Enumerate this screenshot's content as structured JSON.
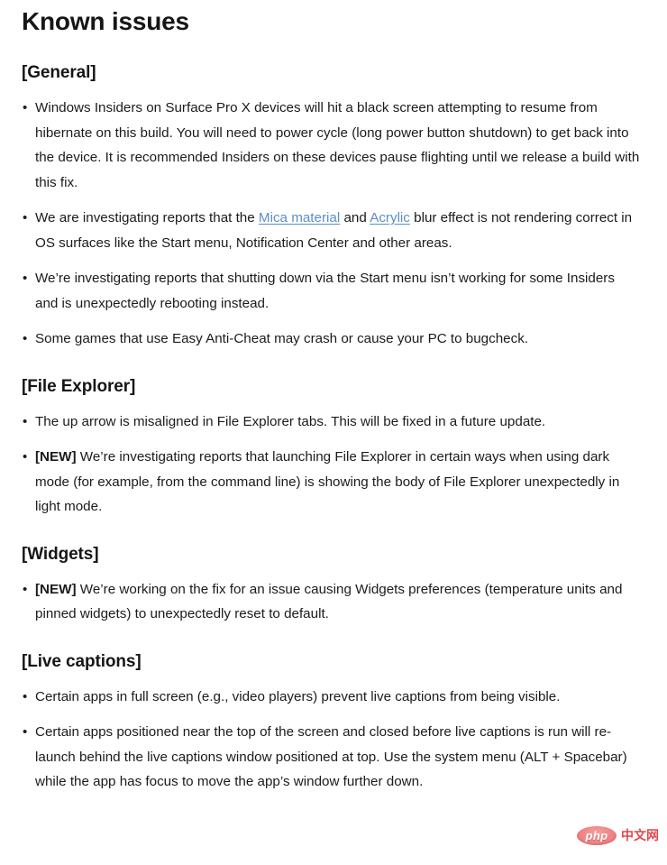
{
  "document": {
    "title": "Known issues",
    "link_color": "#5b8fc7",
    "text_color": "#1b1b1b",
    "background_color": "#ffffff",
    "bullet_glyph": "•",
    "new_tag": "[NEW]"
  },
  "sections": [
    {
      "heading": "[General]",
      "items": [
        {
          "text": "Windows Insiders on Surface Pro X devices will hit a black screen attempting to resume from hibernate on this build. You will need to power cycle (long power button shutdown) to get back into the device. It is recommended Insiders on these devices pause flighting until we release a build with this fix."
        },
        {
          "prefix": "We are investigating reports that the ",
          "link1": "Mica material",
          "mid": " and ",
          "link2": "Acrylic",
          "suffix": " blur effect is not rendering correct in OS surfaces like the Start menu, Notification Center and other areas."
        },
        {
          "text": "We’re investigating reports that shutting down via the Start menu isn’t working for some Insiders and is unexpectedly rebooting instead."
        },
        {
          "text": "Some games that use Easy Anti-Cheat may crash or cause your PC to bugcheck."
        }
      ]
    },
    {
      "heading": "[File Explorer]",
      "items": [
        {
          "text": "The up arrow is misaligned in File Explorer tabs. This will be fixed in a future update."
        },
        {
          "tag": "[NEW]",
          "text": "We’re investigating reports that launching File Explorer in certain ways when using dark mode (for example, from the command line) is showing the body of File Explorer unexpectedly in light mode."
        }
      ]
    },
    {
      "heading": "[Widgets]",
      "items": [
        {
          "tag": "[NEW]",
          "text": "We’re working on the fix for an issue causing Widgets preferences (temperature units and pinned widgets) to unexpectedly reset to default."
        }
      ]
    },
    {
      "heading": "[Live captions]",
      "items": [
        {
          "text": "Certain apps in full screen (e.g., video players) prevent live captions from being visible."
        },
        {
          "text": "Certain apps positioned near the top of the screen and closed before live captions is run will re-launch behind the live captions window positioned at top. Use the system menu (ALT + Spacebar) while the app has focus to move the app’s window further down."
        }
      ]
    }
  ],
  "watermark": {
    "badge_text": "php",
    "site_text": "中文网",
    "badge_color": "#ee8585",
    "site_color": "#e0484c"
  }
}
